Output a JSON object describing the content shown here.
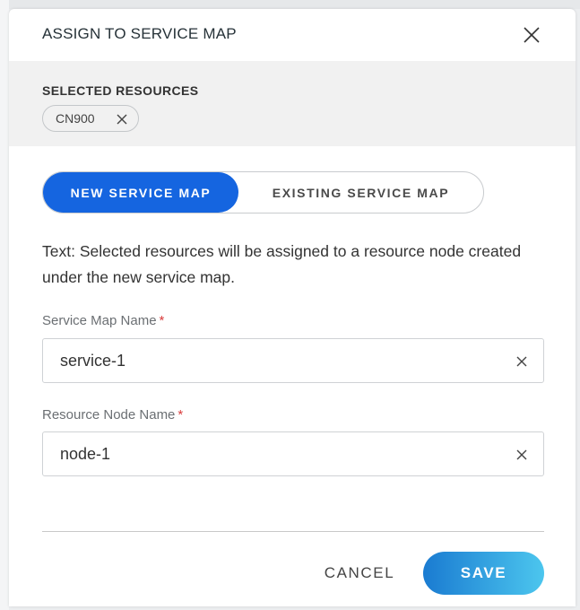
{
  "dialog": {
    "title": "ASSIGN TO SERVICE MAP",
    "close_icon": "close-icon"
  },
  "selected_resources": {
    "label": "SELECTED RESOURCES",
    "chips": [
      {
        "label": "CN900",
        "remove_icon": "close-icon"
      }
    ]
  },
  "mode_toggle": {
    "options": [
      "NEW SERVICE MAP",
      "EXISTING SERVICE MAP"
    ],
    "selected": "NEW SERVICE MAP",
    "active_color": "#1565e0"
  },
  "description": "Text: Selected resources will be assigned to a resource node created under the new service map.",
  "fields": {
    "service_map_name": {
      "label": "Service Map Name",
      "required_marker": "*",
      "value": "service-1"
    },
    "resource_node_name": {
      "label": "Resource Node Name",
      "required_marker": "*",
      "value": "node-1"
    }
  },
  "footer": {
    "cancel_label": "CANCEL",
    "save_label": "SAVE",
    "save_gradient": [
      "#1a7bd1",
      "#4cc6ee"
    ]
  }
}
